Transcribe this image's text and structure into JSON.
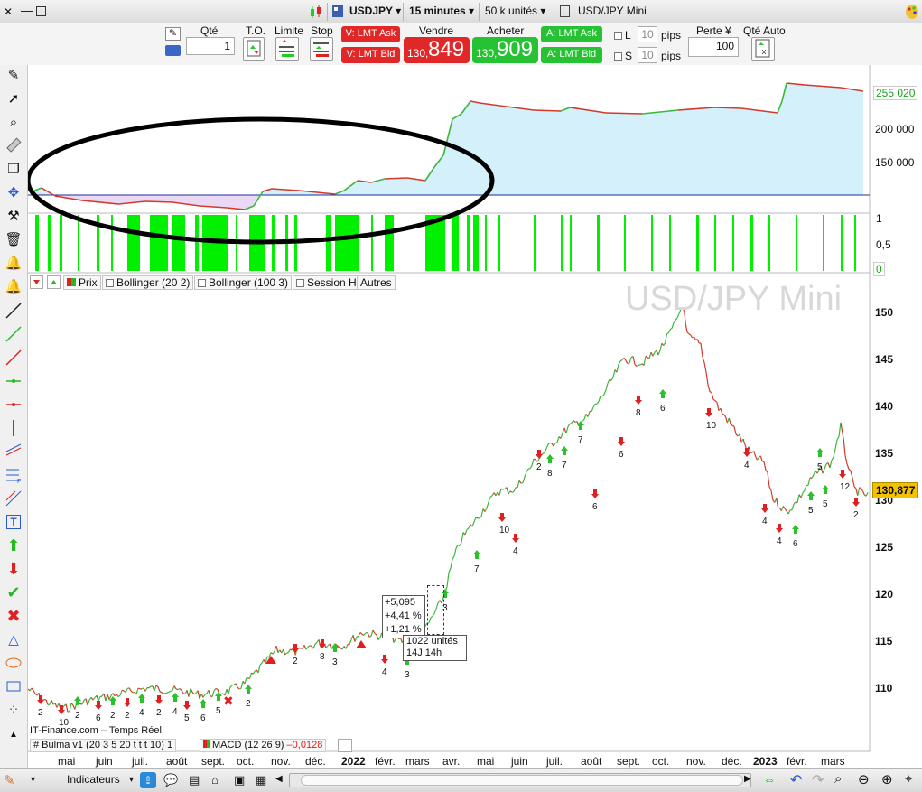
{
  "titlebar": {
    "symbol": "USDJPY",
    "timeframe": "15 minutes",
    "size": "50 k unités",
    "title": "USD/JPY Mini"
  },
  "order": {
    "qty_label": "Qté",
    "qty_value": "1",
    "to_label": "T.O.",
    "limit_label": "Limite",
    "stop_label": "Stop",
    "lmt_ask": "V: LMT Ask",
    "lmt_bid": "V: LMT Bid",
    "sell_label": "Vendre",
    "sell_small": "130,",
    "sell_big": "849",
    "buy_label": "Acheter",
    "buy_small": "130,",
    "buy_big": "909",
    "a_lmt_ask": "A: LMT Ask",
    "a_lmt_bid": "A: LMT Bid",
    "l_label": "L",
    "s_label": "S",
    "l_pips": "10",
    "s_pips": "10",
    "pips": "pips",
    "loss_label": "Perte ¥",
    "loss_value": "100",
    "auto_qty_label": "Qté Auto"
  },
  "equity_axis": [
    "255 020",
    "200 000",
    "150 000"
  ],
  "osc_axis": [
    "1",
    "0,5",
    "0"
  ],
  "legend": {
    "prix": "Prix",
    "boll1": "Bollinger (20 2)",
    "boll2": "Bollinger (100 3)",
    "session": "Session H",
    "autres": "Autres"
  },
  "watermark": "USD/JPY Mini",
  "price_axis": [
    "150",
    "145",
    "140",
    "135",
    "130",
    "125",
    "120",
    "115",
    "110"
  ],
  "last_price": "130,877",
  "source": "IT-Finance.com – Temps Réel",
  "indicators": {
    "bulma": "# Bulma v1 (20 3 5 20 t t t 10)",
    "bulma_n": "1",
    "macd": "MACD (12 26 9)",
    "macd_val": "–0,0128"
  },
  "measure": {
    "l1": "+5,095",
    "l2": "+4,41 %",
    "l3": "+1,21 %",
    "l4": "1022 unités",
    "l5": "14J 14h"
  },
  "time_axis": [
    "mai",
    "juin",
    "juil.",
    "août",
    "sept.",
    "oct.",
    "nov.",
    "déc.",
    "2022",
    "févr.",
    "mars",
    "avr.",
    "mai",
    "juin",
    "juil.",
    "août",
    "sept.",
    "oct.",
    "nov.",
    "déc.",
    "2023",
    "févr.",
    "mars"
  ],
  "signal_labels": [
    "2",
    "10",
    "2",
    "6",
    "2",
    "2",
    "4",
    "2",
    "4",
    "5",
    "6",
    "5",
    "2",
    "2",
    "8",
    "3",
    "4",
    "3",
    "3",
    "7",
    "10",
    "4",
    "2",
    "8",
    "7",
    "7",
    "6",
    "6",
    "8",
    "6",
    "10",
    "4",
    "4",
    "4",
    "6",
    "5",
    "5",
    "5",
    "12",
    "2"
  ],
  "statusbar": {
    "indicators_label": "Indicateurs"
  },
  "colors": {
    "buy_green": "#26c233",
    "sell_red": "#e02828",
    "equity_fill": "#d3f0fb",
    "equity_fill_early": "#ead8f5",
    "osc_green": "#00f000",
    "price_label_bg": "#f2c200",
    "equity_label": "#1aa31a"
  },
  "chart_data": [
    {
      "type": "line",
      "title": "",
      "y_axis_ticks": [
        150000,
        200000
      ],
      "last_value": 255020,
      "x": [
        "mai 2021",
        "oct. 2021",
        "janv. 2022",
        "mars 2022",
        "avr. 2022",
        "août 2022",
        "déc. 2022",
        "janv. 2023",
        "mars 2023"
      ],
      "series": [
        {
          "values": [
            110000,
            100000,
            102000,
            115000,
            240000,
            228000,
            222000,
            262000,
            258000
          ]
        }
      ]
    },
    {
      "type": "line",
      "title": "USD/JPY Mini",
      "ylim": [
        106,
        152
      ],
      "x": [
        "mai 2021",
        "juil. 2021",
        "sept. 2021",
        "nov. 2021",
        "janv. 2022",
        "mars 2022",
        "avr. 2022",
        "juin 2022",
        "août 2022",
        "oct. 2022",
        "oct. 2022",
        "déc. 2022",
        "janv. 2023",
        "févr. 2023",
        "mars 2023",
        "mars 2023"
      ],
      "series": [
        {
          "values": [
            109.5,
            110.0,
            109.8,
            114.0,
            115.5,
            116.0,
            124.0,
            134.0,
            133.0,
            144.0,
            151.5,
            138.0,
            128.5,
            132.0,
            137.5,
            130.9
          ]
        }
      ]
    }
  ]
}
